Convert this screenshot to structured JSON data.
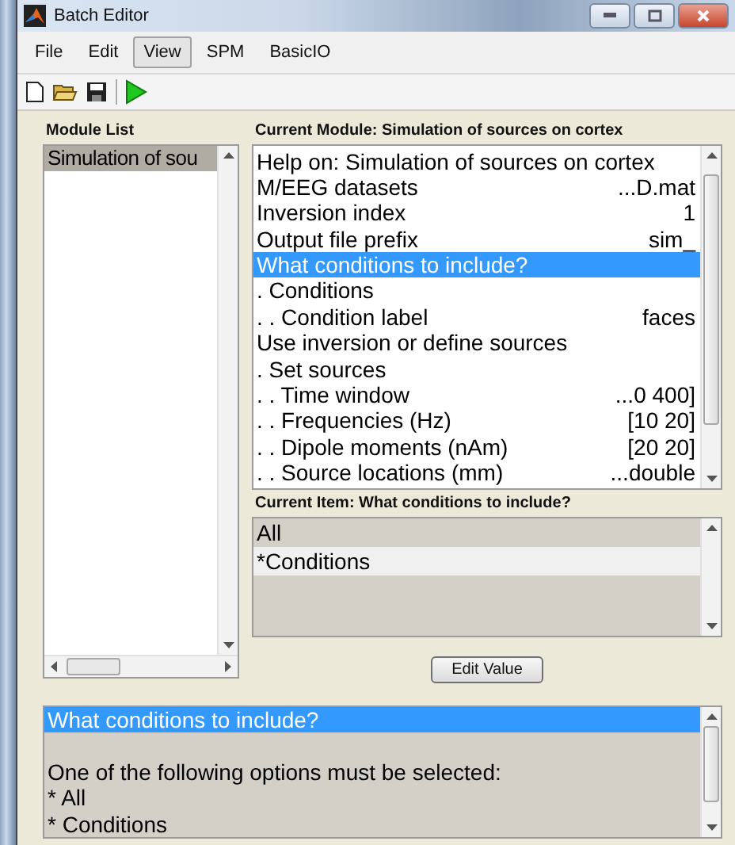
{
  "window": {
    "title": "Batch Editor"
  },
  "menu": [
    {
      "label": "File",
      "selected": false
    },
    {
      "label": "Edit",
      "selected": false
    },
    {
      "label": "View",
      "selected": true
    },
    {
      "label": "SPM",
      "selected": false
    },
    {
      "label": "BasicIO",
      "selected": false
    }
  ],
  "module_list": {
    "label": "Module List",
    "items": [
      {
        "label": "Simulation of sou",
        "selected": true
      }
    ]
  },
  "current_module": {
    "label": "Current Module: Simulation of sources on cortex",
    "rows": [
      {
        "label": "Help on: Simulation of sources on cortex",
        "value": "",
        "selected": false
      },
      {
        "label": "M/EEG datasets",
        "value": "...D.mat",
        "selected": false
      },
      {
        "label": "Inversion index",
        "value": "1",
        "selected": false
      },
      {
        "label": "Output file prefix",
        "value": "sim_",
        "selected": false
      },
      {
        "label": "What conditions to include?",
        "value": "",
        "selected": true
      },
      {
        "label": ". Conditions",
        "value": "",
        "selected": false
      },
      {
        "label": ". . Condition label",
        "value": "faces",
        "selected": false
      },
      {
        "label": "Use inversion or define sources",
        "value": "",
        "selected": false
      },
      {
        "label": ". Set sources",
        "value": "",
        "selected": false
      },
      {
        "label": ". . Time window",
        "value": "...0 400]",
        "selected": false
      },
      {
        "label": ". . Frequencies (Hz)",
        "value": "[10 20]",
        "selected": false
      },
      {
        "label": ". . Dipole moments (nAm)",
        "value": "[20 20]",
        "selected": false
      },
      {
        "label": ". . Source locations (mm)",
        "value": "...double",
        "selected": false
      }
    ]
  },
  "current_item": {
    "label": "Current Item: What conditions to include?",
    "options": [
      {
        "label": "All",
        "selected": false
      },
      {
        "label": "*Conditions",
        "selected": true
      }
    ]
  },
  "edit_button": "Edit Value",
  "help": {
    "title": "What conditions to include?",
    "lines": [
      "One of the following options must be selected:",
      "* All",
      "* Conditions"
    ]
  }
}
